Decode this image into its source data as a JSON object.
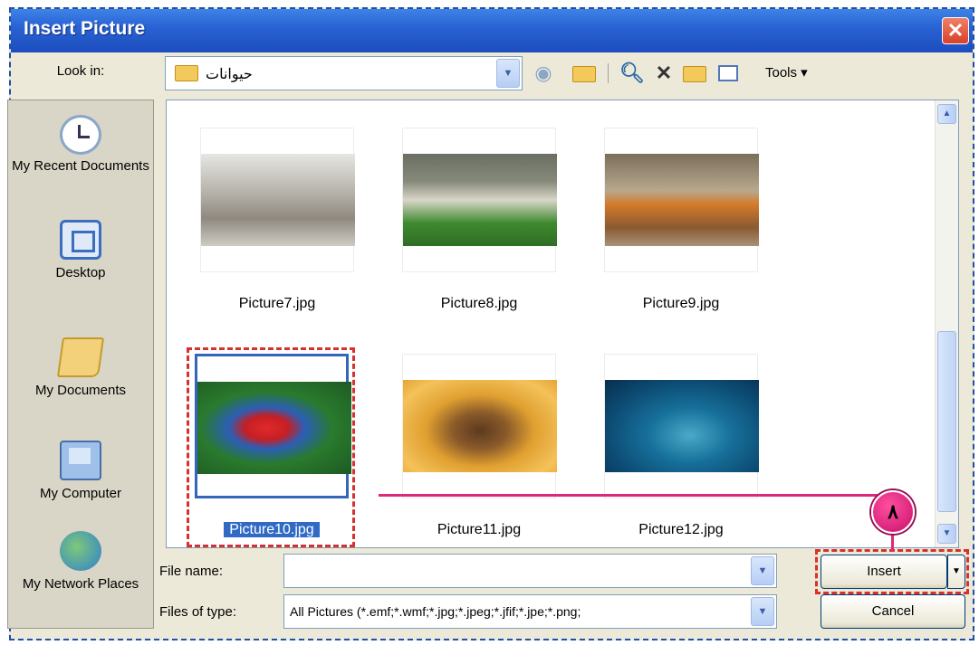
{
  "window": {
    "title": "Insert Picture",
    "close_glyph": "✕"
  },
  "toolbar": {
    "look_in_label": "Look in:",
    "look_in_value": "حيوانات",
    "tools_label": "Tools ▾"
  },
  "places": [
    {
      "label": "My Recent Documents",
      "icon": "recent-documents-icon"
    },
    {
      "label": "Desktop",
      "icon": "desktop-icon"
    },
    {
      "label": "My Documents",
      "icon": "my-documents-icon"
    },
    {
      "label": "My Computer",
      "icon": "my-computer-icon"
    },
    {
      "label": "My Network Places",
      "icon": "network-places-icon"
    }
  ],
  "files": [
    {
      "name": "Picture7.jpg",
      "selected": false
    },
    {
      "name": "Picture8.jpg",
      "selected": false
    },
    {
      "name": "Picture9.jpg",
      "selected": false
    },
    {
      "name": "Picture10.jpg",
      "selected": true
    },
    {
      "name": "Picture11.jpg",
      "selected": false
    },
    {
      "name": "Picture12.jpg",
      "selected": false
    }
  ],
  "form": {
    "file_name_label": "File name:",
    "file_name_value": "",
    "file_type_label": "Files of type:",
    "file_type_value": "All Pictures (*.emf;*.wmf;*.jpg;*.jpeg;*.jfif;*.jpe;*.png;"
  },
  "buttons": {
    "insert_label": "Insert",
    "cancel_label": "Cancel"
  },
  "annotation": {
    "step_number": "٨",
    "accent_color": "#e0287a"
  }
}
